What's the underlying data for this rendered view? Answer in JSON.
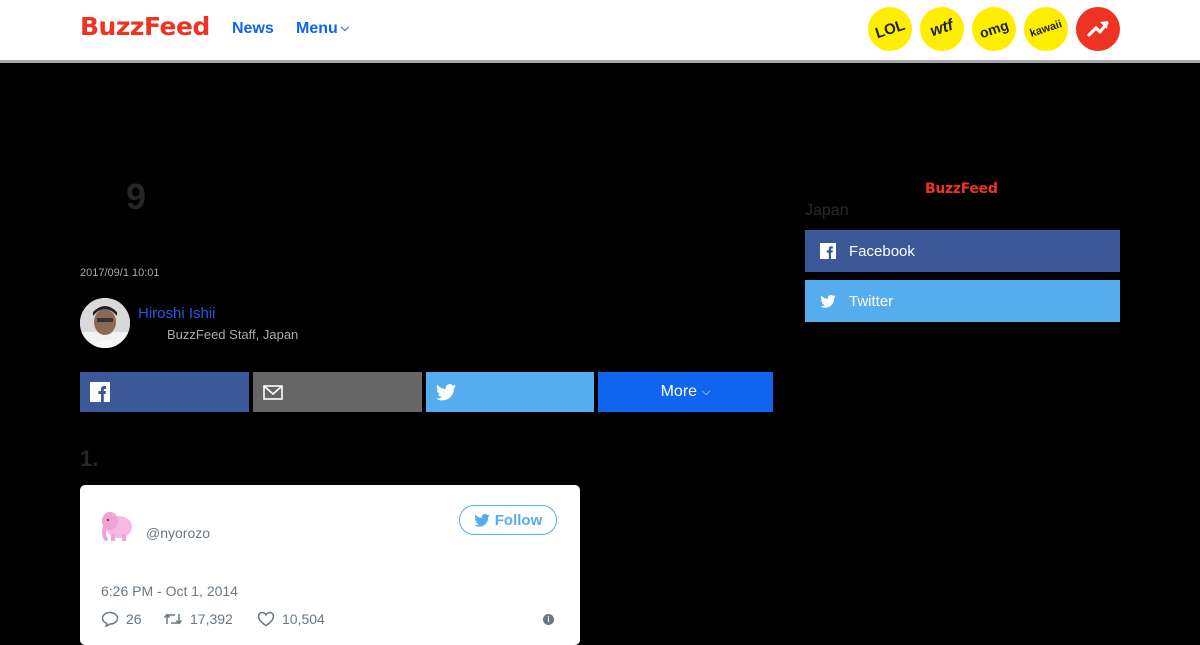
{
  "header": {
    "logo": "BuzzFeed",
    "nav": {
      "news": "News",
      "menu": "Menu"
    },
    "badges": [
      "LOL",
      "wtf",
      "omg",
      "kawaii"
    ],
    "icons": [
      "chevron-down-icon",
      "trending-icon"
    ],
    "colors": {
      "brand": "#ee3322",
      "link": "#0f65ef",
      "badge": "#ffee00"
    }
  },
  "article": {
    "number": "9",
    "timestamp": "2017/09/1 10:01",
    "author": {
      "name": "Hiroshi Ishii",
      "role": "BuzzFeed Staff, Japan"
    },
    "share": {
      "more_label": "More"
    },
    "list_number": "1."
  },
  "tweet": {
    "handle": "@nyorozo",
    "follow_label": "Follow",
    "time": "6:26 PM - Oct 1, 2014",
    "replies": "26",
    "retweets": "17,392",
    "likes": "10,504"
  },
  "sidebar": {
    "logo": "BuzzFeed",
    "region": "Japan",
    "facebook_label": "Facebook",
    "twitter_label": "Twitter",
    "colors": {
      "facebook": "#3b5998",
      "twitter": "#55acee"
    }
  }
}
